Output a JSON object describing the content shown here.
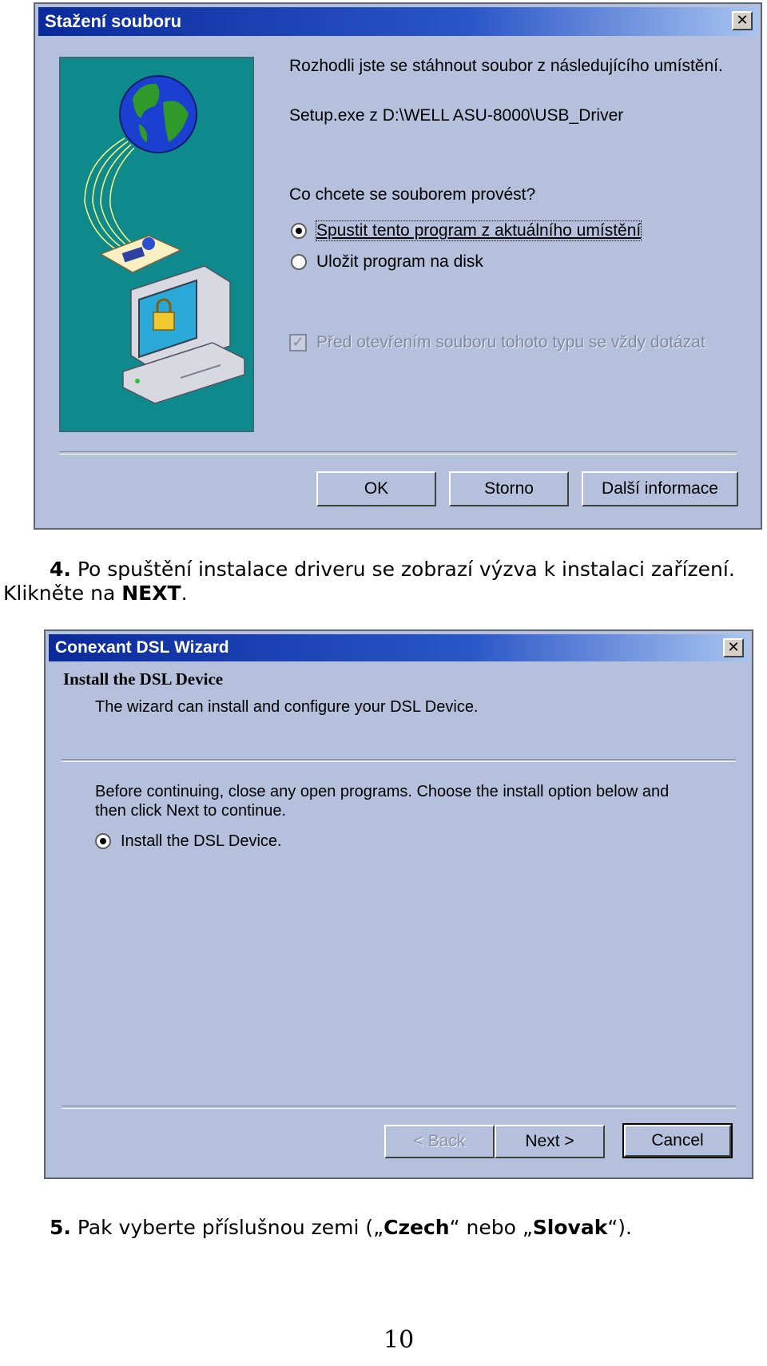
{
  "dialog1": {
    "title": "Stažení souboru",
    "close_glyph": "✕",
    "intro": "Rozhodli jste se stáhnout soubor z následujícího umístění.",
    "location": "Setup.exe z D:\\WELL ASU-8000\\USB_Driver",
    "question": "Co chcete se souborem provést?",
    "options": [
      {
        "label": "Spustit tento program z aktuálního umístění",
        "selected": true
      },
      {
        "label": "Uložit program na disk",
        "selected": false
      }
    ],
    "always_ask": {
      "label": "Před otevřením souboru tohoto typu se vždy dotázat",
      "checked": true,
      "disabled": true
    },
    "buttons": {
      "ok": "OK",
      "cancel": "Storno",
      "more_info": "Další informace"
    },
    "illustration_icon": "globe-download-computer-lock-icon"
  },
  "caption4": {
    "number": "4.",
    "text": " Po spuštění instalace driveru se zobrazí výzva k instalaci zařízení.",
    "line2_prefix": "Klikněte na ",
    "line2_bold": "NEXT",
    "line2_suffix": "."
  },
  "dialog2": {
    "title": "Conexant DSL Wizard",
    "close_glyph": "✕",
    "heading": "Install the DSL Device",
    "subheading": "The wizard can install and configure your DSL Device.",
    "instruction_line1": "Before continuing, close any open programs.  Choose the install option below and",
    "instruction_line2": "then click Next to continue.",
    "option": {
      "label": "Install the DSL Device.",
      "selected": true
    },
    "buttons": {
      "back": "< Back",
      "next": "Next >",
      "cancel": "Cancel"
    }
  },
  "caption5": {
    "number": "5.",
    "text_a": " Pak vyberte příslušnou zemi („",
    "bold_a": "Czech",
    "text_b": "“ nebo „",
    "bold_b": "Slovak",
    "text_c": "“)."
  },
  "page_number": "10",
  "colors": {
    "dialog_bg": "#b4c0dc",
    "title_start": "#0a2a9c",
    "title_end": "#a8c4f0",
    "illustration_bg": "#0f8a8c"
  }
}
